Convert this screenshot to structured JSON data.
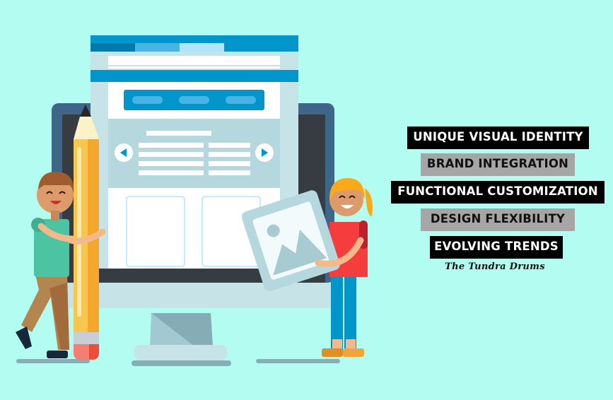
{
  "features": [
    {
      "label": "UNIQUE VISUAL IDENTITY",
      "style": "dark"
    },
    {
      "label": "BRAND INTEGRATION",
      "style": "grey"
    },
    {
      "label": "FUNCTIONAL CUSTOMIZATION",
      "style": "dark"
    },
    {
      "label": "DESIGN FLEXIBILITY",
      "style": "grey"
    },
    {
      "label": "EVOLVING TRENDS",
      "style": "dark"
    }
  ],
  "brand": "The Tundra Drums",
  "colors": {
    "background": "#b2fcf2",
    "accent_blue": "#0096cc",
    "monitor_frame": "#3d6688",
    "label_dark": "#000000",
    "label_grey": "#a6a6a6"
  }
}
